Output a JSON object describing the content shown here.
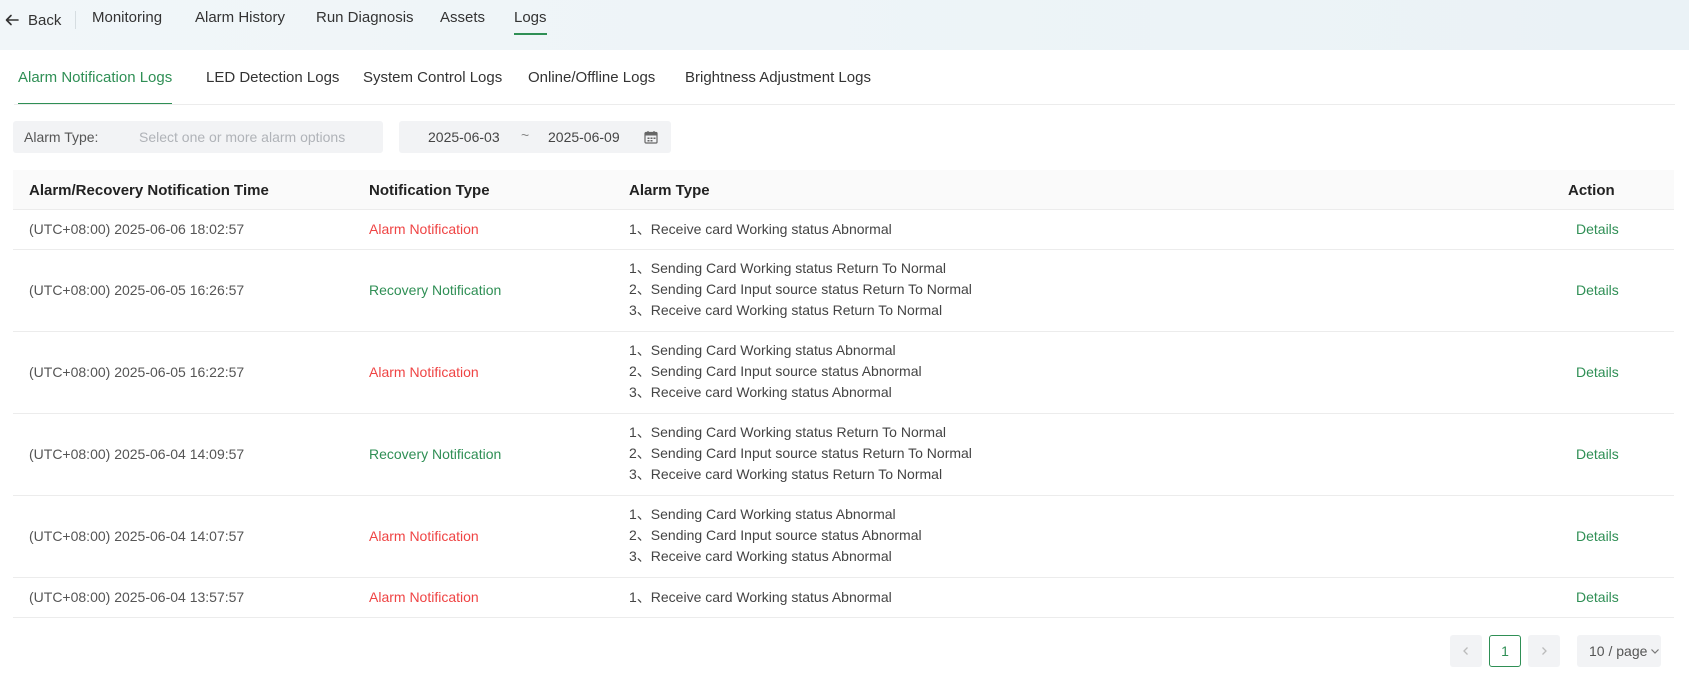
{
  "topbar": {
    "back_label": "Back",
    "nav": [
      "Monitoring",
      "Alarm History",
      "Run Diagnosis",
      "Assets",
      "Logs"
    ],
    "active_nav": "Logs"
  },
  "subtabs": [
    "Alarm Notification Logs",
    "LED Detection Logs",
    "System Control Logs",
    "Online/Offline Logs",
    "Brightness Adjustment Logs"
  ],
  "filters": {
    "alarm_type_label": "Alarm Type:",
    "alarm_type_placeholder": "Select one or more alarm options",
    "date_start": "2025-06-03",
    "date_separator": "~",
    "date_end": "2025-06-09"
  },
  "table": {
    "columns": [
      "Alarm/Recovery Notification Time",
      "Notification Type",
      "Alarm Type",
      "Action"
    ],
    "rows": [
      {
        "time": "(UTC+08:00) 2025-06-06 18:02:57",
        "type": "Alarm Notification",
        "kind": "alarm",
        "alarms": [
          "1、Receive card Working status Abnormal"
        ],
        "action": "Details"
      },
      {
        "time": "(UTC+08:00) 2025-06-05 16:26:57",
        "type": "Recovery Notification",
        "kind": "recovery",
        "alarms": [
          "1、Sending Card Working status Return To Normal",
          "2、Sending Card Input source status Return To Normal",
          "3、Receive card Working status Return To Normal"
        ],
        "action": "Details"
      },
      {
        "time": "(UTC+08:00) 2025-06-05 16:22:57",
        "type": "Alarm Notification",
        "kind": "alarm",
        "alarms": [
          "1、Sending Card Working status Abnormal",
          "2、Sending Card Input source status Abnormal",
          "3、Receive card Working status Abnormal"
        ],
        "action": "Details"
      },
      {
        "time": "(UTC+08:00) 2025-06-04 14:09:57",
        "type": "Recovery Notification",
        "kind": "recovery",
        "alarms": [
          "1、Sending Card Working status Return To Normal",
          "2、Sending Card Input source status Return To Normal",
          "3、Receive card Working status Return To Normal"
        ],
        "action": "Details"
      },
      {
        "time": "(UTC+08:00) 2025-06-04 14:07:57",
        "type": "Alarm Notification",
        "kind": "alarm",
        "alarms": [
          "1、Sending Card Working status Abnormal",
          "2、Sending Card Input source status Abnormal",
          "3、Receive card Working status Abnormal"
        ],
        "action": "Details"
      },
      {
        "time": "(UTC+08:00) 2025-06-04 13:57:57",
        "type": "Alarm Notification",
        "kind": "alarm",
        "alarms": [
          "1、Receive card Working status Abnormal"
        ],
        "action": "Details"
      }
    ]
  },
  "pagination": {
    "current_page": "1",
    "page_size": "10 / page"
  },
  "colors": {
    "accent": "#2f8f55",
    "alarm": "#ef4444",
    "recovery": "#2f8f55"
  }
}
